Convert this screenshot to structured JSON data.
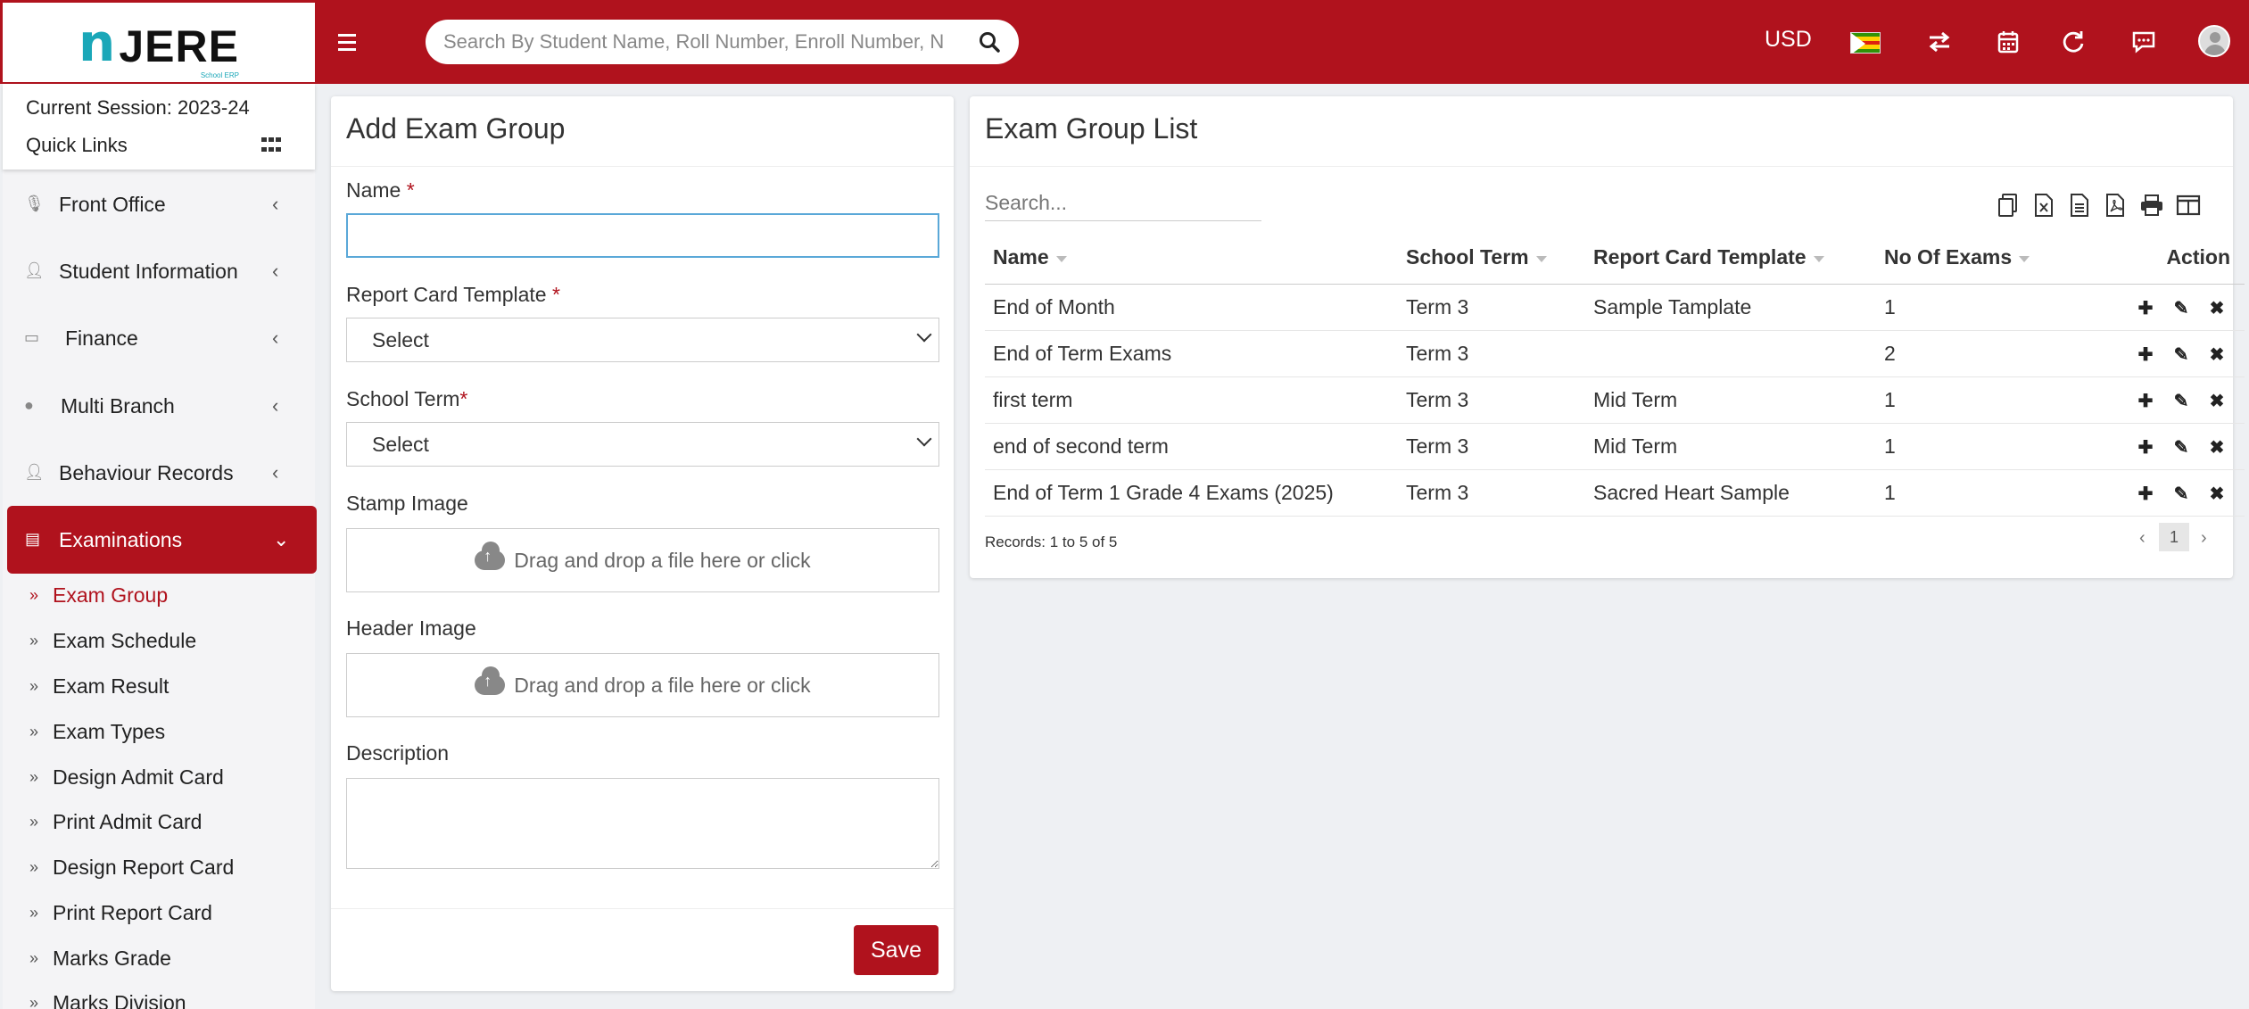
{
  "header": {
    "logo_n": "n",
    "logo_text": "JERE",
    "logo_sub": "School ERP",
    "search_placeholder": "Search By Student Name, Roll Number, Enroll Number, N",
    "currency": "USD",
    "flag_colors": [
      "#319208",
      "#FFD200",
      "#DE2010",
      "#000000",
      "#FFFFFF"
    ],
    "icons": [
      "menu-icon",
      "search-icon",
      "flag-icon",
      "switch-arrows-icon",
      "calendar-icon",
      "refresh-icon",
      "chat-icon",
      "avatar-icon"
    ]
  },
  "sidebar": {
    "session": "Current Session: 2023-24",
    "quick_links": "Quick Links",
    "nav": [
      {
        "label": "Front Office",
        "icon": "microphone-icon"
      },
      {
        "label": "Student Information",
        "icon": "user-icon"
      },
      {
        "label": "Finance",
        "icon": "card-icon"
      },
      {
        "label": "Multi Branch",
        "icon": "location-icon"
      },
      {
        "label": "Behaviour Records",
        "icon": "user-icon"
      },
      {
        "label": "Examinations",
        "icon": "exam-icon"
      }
    ],
    "sub": [
      {
        "label": "Exam Group"
      },
      {
        "label": "Exam Schedule"
      },
      {
        "label": "Exam Result"
      },
      {
        "label": "Exam Types"
      },
      {
        "label": "Design Admit Card"
      },
      {
        "label": "Print Admit Card"
      },
      {
        "label": "Design Report Card"
      },
      {
        "label": "Print Report Card"
      },
      {
        "label": "Marks Grade"
      },
      {
        "label": "Marks Division"
      }
    ]
  },
  "form": {
    "title": "Add Exam Group",
    "name_label": "Name",
    "required_mark": "*",
    "name_value": "",
    "template_label": "Report Card Template",
    "template_value": "Select",
    "term_label": "School Term",
    "term_value": "Select",
    "stamp_label": "Stamp Image",
    "stamp_drop": "Drag and drop a file here or click",
    "header_label": "Header Image",
    "header_drop": "Drag and drop a file here or click",
    "description_label": "Description",
    "save_label": "Save"
  },
  "list": {
    "title": "Exam Group List",
    "search_placeholder": "Search...",
    "columns": {
      "name": "Name",
      "term": "School Term",
      "template": "Report Card Template",
      "exams": "No Of Exams",
      "action": "Action"
    },
    "rows": [
      {
        "name": "End of Month",
        "term": "Term 3",
        "template": "Sample Tamplate",
        "exams": "1"
      },
      {
        "name": "End of Term Exams",
        "term": "Term 3",
        "template": "",
        "exams": "2"
      },
      {
        "name": "first term",
        "term": "Term 3",
        "template": "Mid Term",
        "exams": "1"
      },
      {
        "name": "end of second term",
        "term": "Term 3",
        "template": "Mid Term",
        "exams": "1"
      },
      {
        "name": "End of Term 1 Grade 4 Exams (2025)",
        "term": "Term 3",
        "template": "Sacred Heart Sample",
        "exams": "1"
      }
    ],
    "records": "Records: 1 to 5 of 5",
    "page": "1",
    "export_icons": [
      "copy-icon",
      "excel-icon",
      "csv-icon",
      "pdf-icon",
      "print-icon",
      "columns-icon"
    ],
    "action_icons": [
      "add-icon",
      "edit-icon",
      "delete-icon"
    ]
  }
}
